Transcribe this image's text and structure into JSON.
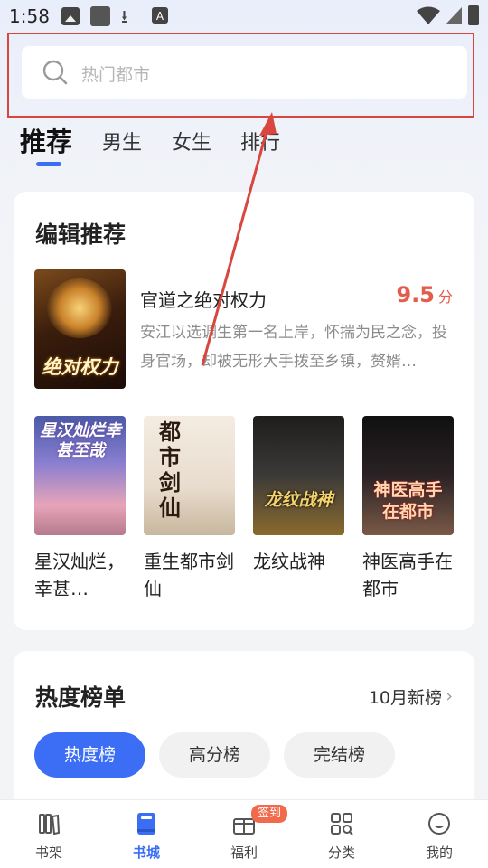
{
  "status_bar": {
    "time": "1:58",
    "icons": [
      "image-icon",
      "app-icon",
      "download-icon",
      "a-icon",
      "wifi-icon",
      "signal-icon",
      "battery-icon"
    ]
  },
  "search": {
    "placeholder": "热门都市"
  },
  "tabs": [
    {
      "label": "推荐",
      "active": true
    },
    {
      "label": "男生",
      "active": false
    },
    {
      "label": "女生",
      "active": false
    },
    {
      "label": "排行",
      "active": false
    }
  ],
  "editor_picks": {
    "title": "编辑推荐",
    "featured": {
      "title": "官道之绝对权力",
      "score": "9.5",
      "score_unit": "分",
      "description": "安江以选调生第一名上岸，怀揣为民之念，投身官场，却被无形大手拨至乡镇，赘婿…",
      "cover_text": "绝对权力"
    },
    "books": [
      {
        "name": "星汉灿烂，幸甚…",
        "cover_text": "星汉灿烂幸甚至哉"
      },
      {
        "name": "重生都市剑仙",
        "cover_text": "都市剑仙"
      },
      {
        "name": "龙纹战神",
        "cover_text": "龙纹战神"
      },
      {
        "name": "神医高手在都市",
        "cover_text": "神医高手在都市"
      }
    ]
  },
  "ranking": {
    "title": "热度榜单",
    "more_label": "10月新榜",
    "pills": [
      {
        "label": "热度榜",
        "active": true
      },
      {
        "label": "高分榜",
        "active": false
      },
      {
        "label": "完结榜",
        "active": false
      }
    ]
  },
  "bottom_nav": {
    "items": [
      {
        "label": "书架",
        "icon": "bookshelf-icon",
        "active": false
      },
      {
        "label": "书城",
        "icon": "bookstore-icon",
        "active": true
      },
      {
        "label": "福利",
        "icon": "gift-icon",
        "active": false
      },
      {
        "label": "分类",
        "icon": "category-icon",
        "active": false
      },
      {
        "label": "我的",
        "icon": "profile-icon",
        "active": false
      }
    ],
    "badge": "签到"
  },
  "colors": {
    "accent": "#3b6ef5",
    "score": "#e35c4c",
    "annotation": "#d9463e",
    "badge": "#f26a4b"
  }
}
